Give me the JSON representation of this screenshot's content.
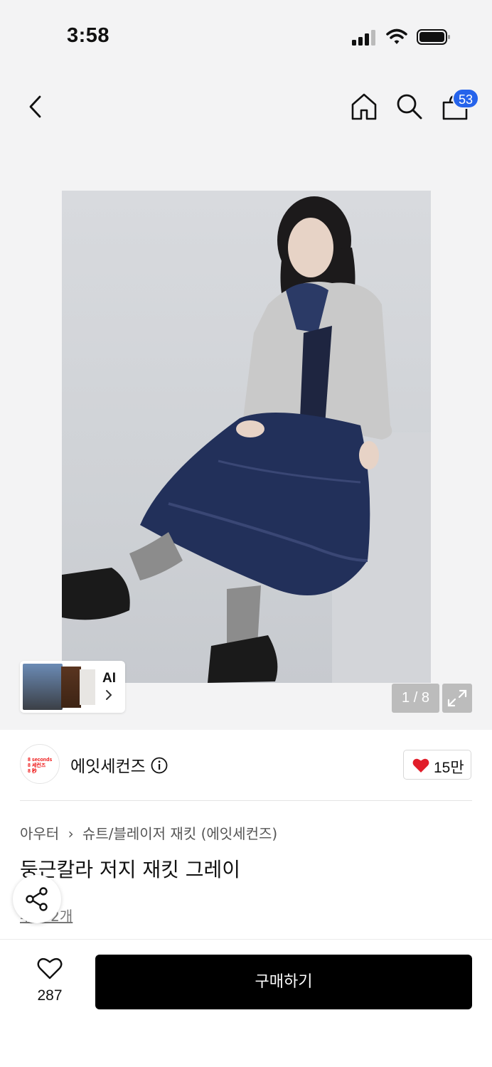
{
  "status_bar": {
    "time": "3:58"
  },
  "header": {
    "cart_count": "53"
  },
  "gallery": {
    "ai_label": "AI",
    "pager": "1 / 8"
  },
  "brand": {
    "logo_lines": [
      "8 seconds",
      "8 세컨즈",
      "8 秒"
    ],
    "name": "에잇세컨즈",
    "likes": "15만"
  },
  "product": {
    "breadcrumbs": [
      "아우터",
      "슈트/블레이저 재킷 (에잇세컨즈)"
    ],
    "title": "둥근칼라 저지 재킷 그레이",
    "reviews": "후기 2개"
  },
  "bottom": {
    "wish_count": "287",
    "buy_label": "구매하기"
  },
  "colors": {
    "accent": "#2563eb",
    "heart": "#e11d2a",
    "buy_bg": "#000000"
  }
}
